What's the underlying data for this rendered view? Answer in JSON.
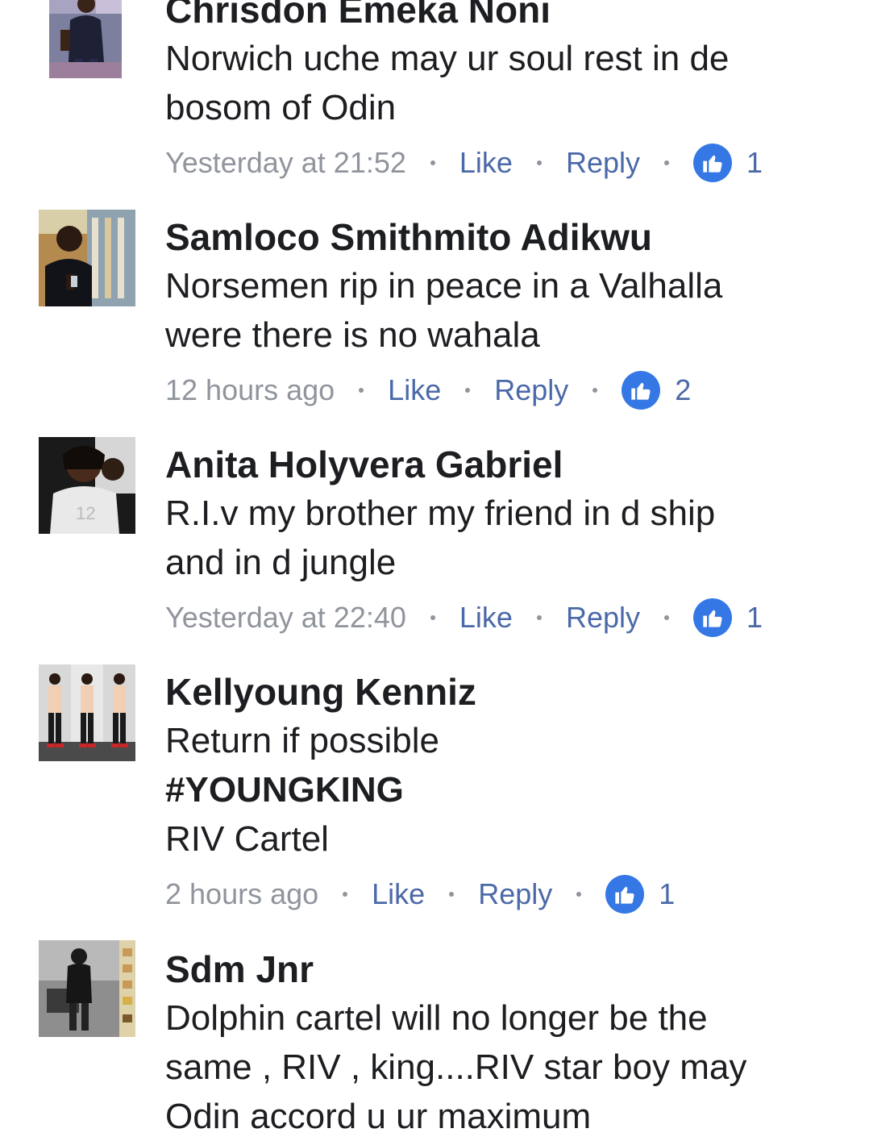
{
  "comments": [
    {
      "author": "Chrisdon Emeka Noni",
      "lines": [
        "Norwich uche may ur soul rest in de",
        "bosom of Odin"
      ],
      "time": "Yesterday at 21:52",
      "like_label": "Like",
      "reply_label": "Reply",
      "likes": "1",
      "avatar": "avatar-photo"
    },
    {
      "author": "Samloco Smithmito Adikwu",
      "lines": [
        "Norsemen rip in peace in a Valhalla",
        "were there is no wahala"
      ],
      "time": "12 hours ago",
      "like_label": "Like",
      "reply_label": "Reply",
      "likes": "2",
      "avatar": "avatar-photo"
    },
    {
      "author": "Anita Holyvera Gabriel",
      "lines": [
        "R.I.v my brother my friend in d ship",
        "and in d jungle"
      ],
      "time": "Yesterday at 22:40",
      "like_label": "Like",
      "reply_label": "Reply",
      "likes": "1",
      "avatar": "avatar-photo"
    },
    {
      "author": "Kellyoung Kenniz",
      "lines": [
        "Return if possible",
        "#YOUNGKING",
        "RIV Cartel"
      ],
      "time": "2 hours ago",
      "like_label": "Like",
      "reply_label": "Reply",
      "likes": "1",
      "avatar": "avatar-photo"
    },
    {
      "author": "Sdm Jnr",
      "lines": [
        "Dolphin cartel will no longer be the",
        "same , RIV , king....RIV star boy may",
        "Odin accord u ur maximum"
      ],
      "avatar": "avatar-photo"
    }
  ],
  "colors": {
    "link": "#4b69a8",
    "meta": "#90949c",
    "like_badge": "#3578e5",
    "text": "#1c1e21"
  },
  "icons": {
    "reaction": "thumbs-up-icon"
  }
}
